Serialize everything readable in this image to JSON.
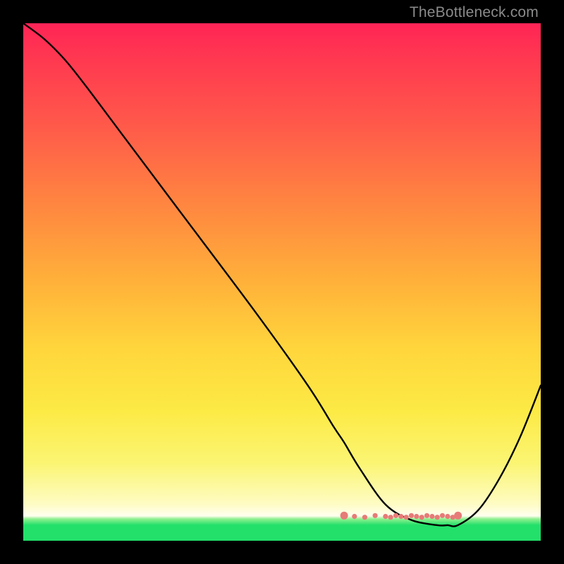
{
  "watermark": "TheBottleneck.com",
  "chart_data": {
    "type": "line",
    "title": "",
    "xlabel": "",
    "ylabel": "",
    "xlim": [
      0,
      100
    ],
    "ylim": [
      0,
      100
    ],
    "grid": false,
    "series": [
      {
        "name": "curve",
        "color": "#000000",
        "x": [
          0,
          4,
          8,
          12,
          18,
          30,
          45,
          55,
          60,
          62,
          65,
          70,
          75,
          80,
          82,
          84,
          88,
          92,
          96,
          100
        ],
        "values": [
          100,
          97,
          93,
          88,
          80,
          64,
          44,
          30,
          22,
          19,
          14,
          7,
          4,
          3,
          3,
          3,
          6,
          12,
          20,
          30
        ]
      },
      {
        "name": "flat-zone-markers",
        "color": "#e77b77",
        "type": "scatter",
        "x": [
          62,
          64,
          66,
          68,
          70,
          71,
          72,
          73,
          74,
          75,
          76,
          77,
          78,
          79,
          80,
          81,
          82,
          83,
          84
        ],
        "values": [
          3,
          3,
          3,
          3,
          3,
          3,
          3,
          3,
          3,
          3,
          3,
          3,
          3,
          3,
          3,
          3,
          3,
          3,
          3
        ]
      }
    ],
    "annotations": []
  }
}
